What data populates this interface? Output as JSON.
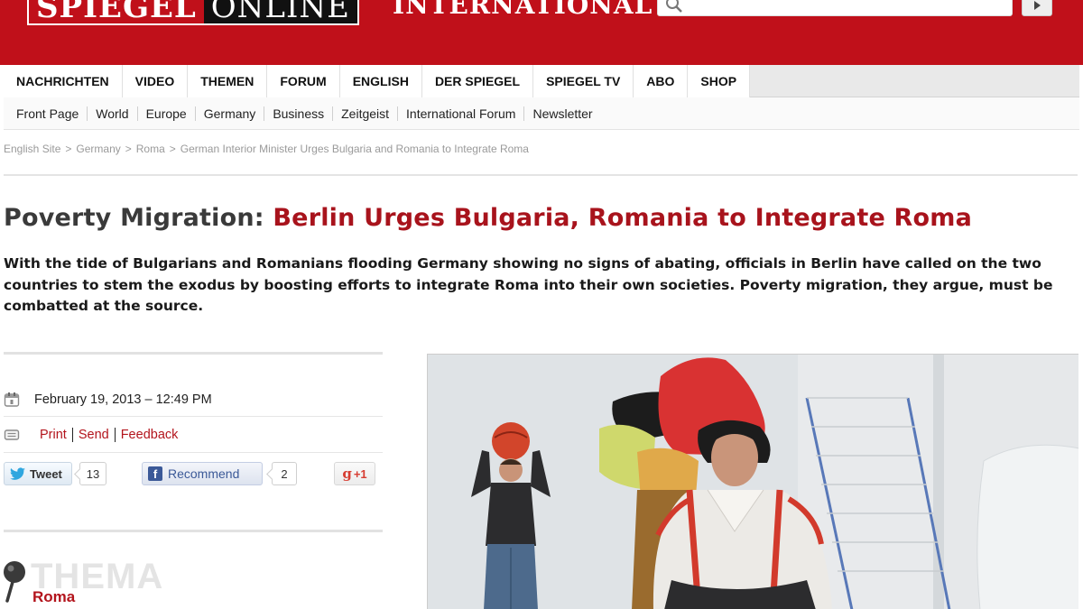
{
  "header": {
    "logo_part1": "SPIEGEL",
    "logo_part2": "ONLINE",
    "edition": "INTERNATIONAL",
    "search_placeholder": "",
    "search_icon": "search-icon",
    "search_button_icon": "arrow-right-icon",
    "brand_color": "#c0101a"
  },
  "mainnav": {
    "items": [
      "NACHRICHTEN",
      "VIDEO",
      "THEMEN",
      "FORUM",
      "ENGLISH",
      "DER SPIEGEL",
      "SPIEGEL TV",
      "ABO",
      "SHOP"
    ]
  },
  "subnav": {
    "items": [
      "Front Page",
      "World",
      "Europe",
      "Germany",
      "Business",
      "Zeitgeist",
      "International Forum",
      "Newsletter"
    ]
  },
  "breadcrumb": {
    "items": [
      "English Site",
      "Germany",
      "Roma",
      "German Interior Minister Urges Bulgaria and Romania to Integrate Roma"
    ],
    "separator": ">"
  },
  "article": {
    "kicker": "Poverty Migration:",
    "title": "Berlin Urges Bulgaria, Romania to Integrate Roma",
    "intro": "With the tide of Bulgarians and Romanians flooding Germany showing no signs of abating, officials in Berlin have called on the two countries to stem the exodus by boosting efforts to integrate Roma into their own societies. Poverty migration, they argue, must be combatted at the source.",
    "date": "February 19, 2013 – 12:49 PM",
    "date_icon": "calendar-icon",
    "actions_icon": "printer-icon",
    "actions": [
      "Print",
      "Send",
      "Feedback"
    ],
    "photo_alt": "photo"
  },
  "social": {
    "tweet_label": "Tweet",
    "tweet_icon": "twitter-bird-icon",
    "tweet_count": "13",
    "recommend_label": "Recommend",
    "recommend_icon": "facebook-icon",
    "recommend_count": "2",
    "gplus_label": "+1",
    "gplus_icon": "google-plus-icon"
  },
  "thema": {
    "label": "THEMA",
    "topic": "Roma",
    "icon": "pin-icon"
  },
  "colors": {
    "accent_red": "#a8131c",
    "link_red": "#b3141c",
    "nav_bg": "#e9e9e9"
  }
}
